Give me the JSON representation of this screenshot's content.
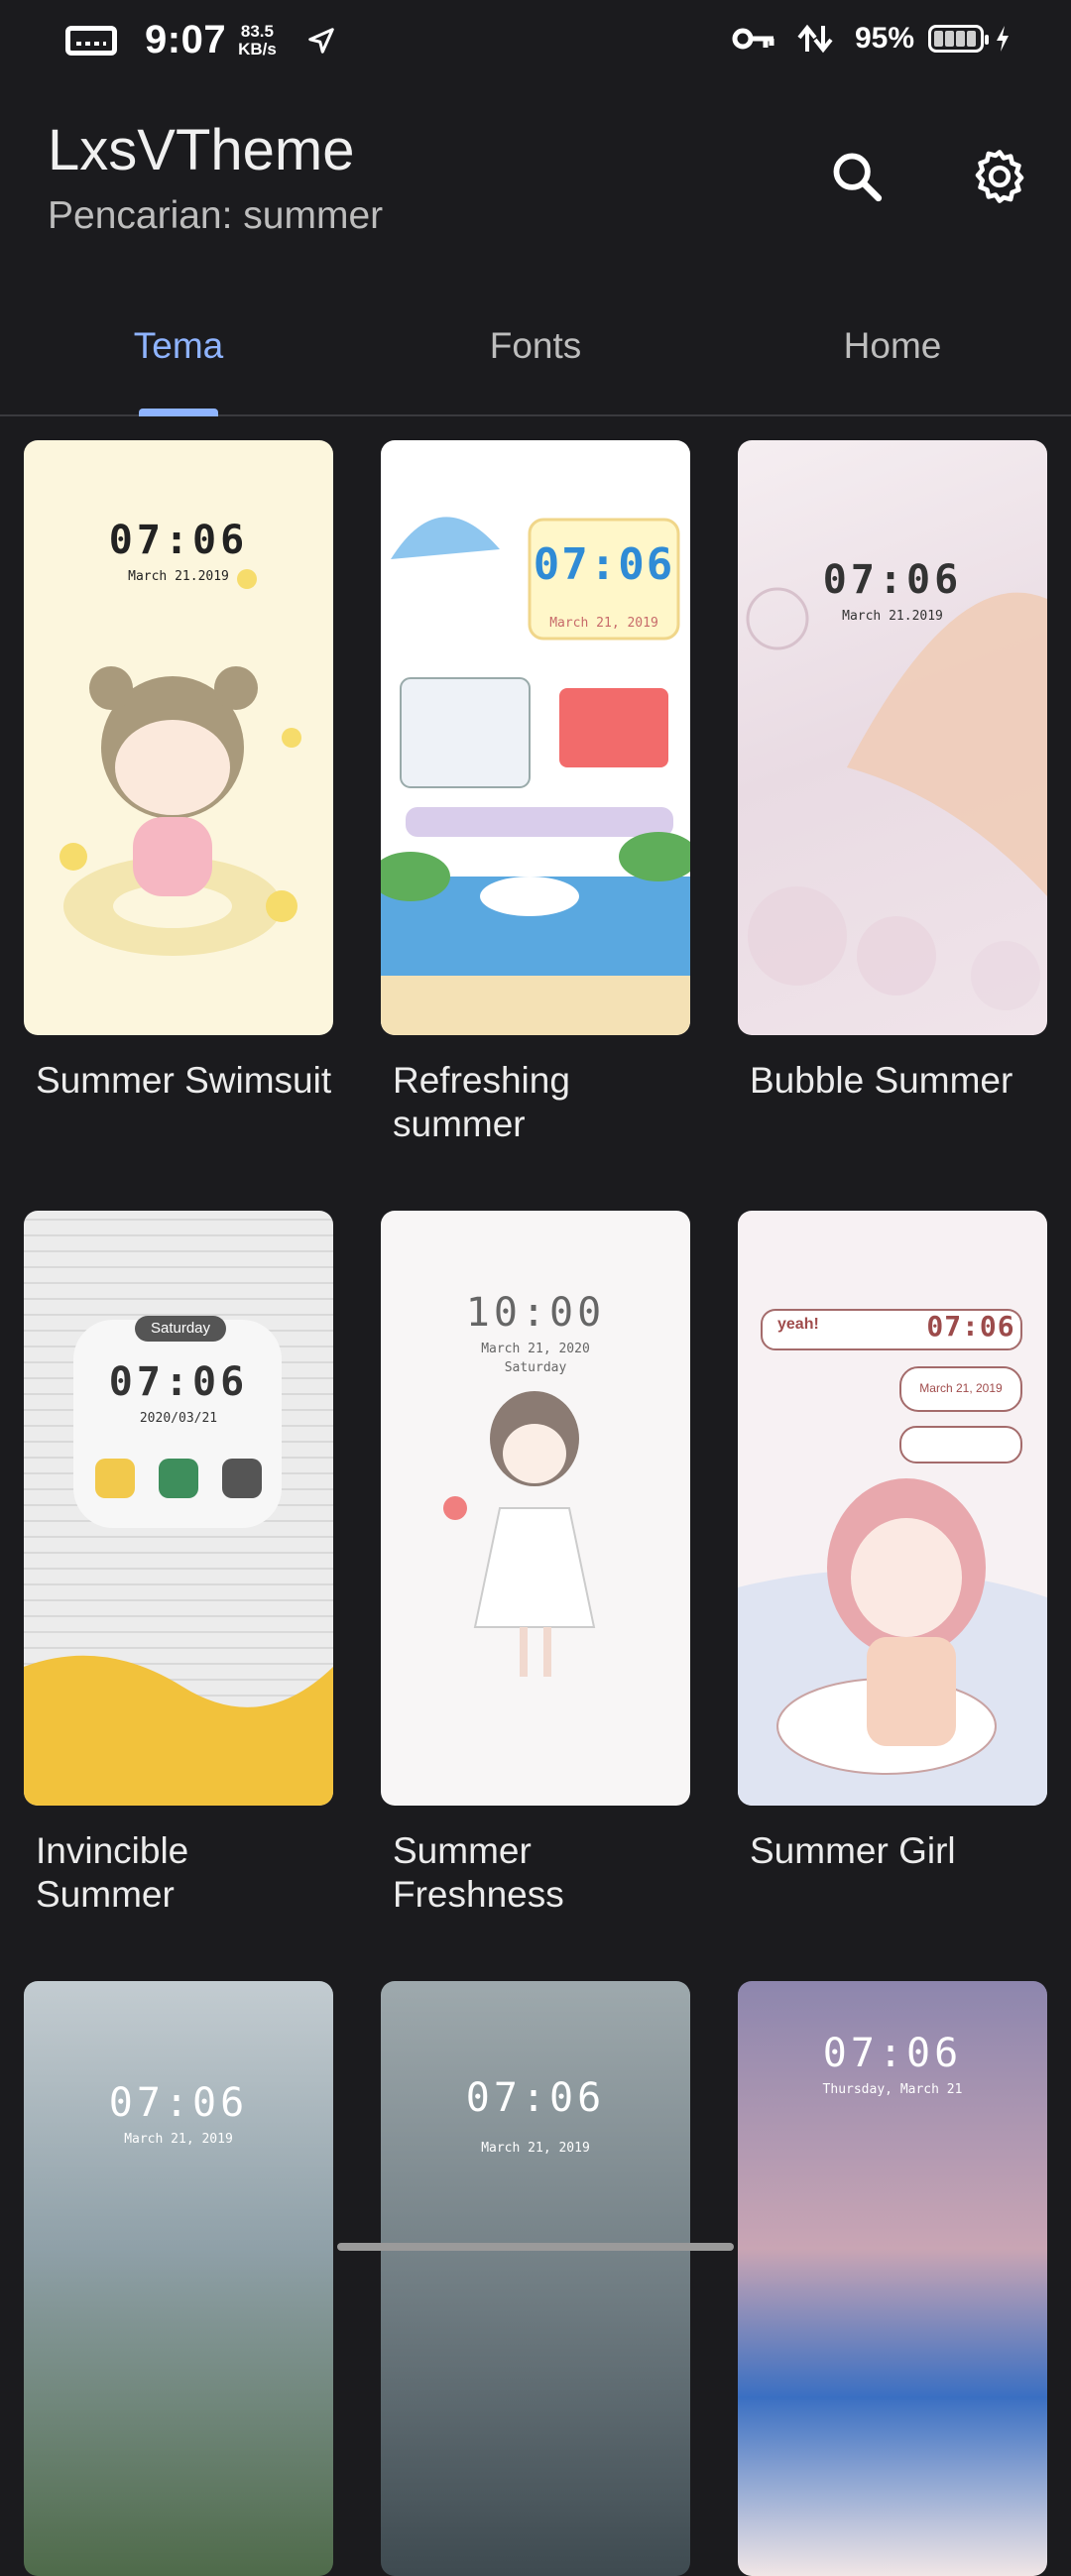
{
  "status_bar": {
    "time": "9:07",
    "speed_value": "83.5",
    "speed_unit": "KB/s",
    "battery": "95%"
  },
  "appbar": {
    "title": "LxsVTheme",
    "subtitle": "Pencarian: summer",
    "icons": [
      "search-icon",
      "gear-icon"
    ]
  },
  "tabs": [
    {
      "label": "Tema",
      "active": true
    },
    {
      "label": "Fonts",
      "active": false
    },
    {
      "label": "Home",
      "active": false
    }
  ],
  "themes": [
    {
      "title": "Summer Swimsuit",
      "clock": "07:06",
      "date": "March 21.2019",
      "bg": "#fcf6dd"
    },
    {
      "title": "Refreshing summer",
      "clock": "07:06",
      "date": "March 21, 2019",
      "bg": "#ffffff"
    },
    {
      "title": "Bubble Summer",
      "clock": "07:06",
      "date": "March 21.2019",
      "bg": "#efe6ec"
    },
    {
      "title": "Invincible Summer",
      "clock": "07:06",
      "date": "2020/03/21",
      "day": "Saturday",
      "bg": "#e6e6e6"
    },
    {
      "title": "Summer Freshness",
      "clock": "10:00",
      "date": "March 21, 2020",
      "day": "Saturday",
      "bg": "#f8f6f6"
    },
    {
      "title": "Summer Girl",
      "clock": "07:06",
      "date": "March 21, 2019",
      "day": "yeah!",
      "bg": "#f7f1f3"
    },
    {
      "title": "",
      "clock": "07:06",
      "date": "March 21, 2019",
      "bg": "#8fa0a8"
    },
    {
      "title": "",
      "clock": "07:06",
      "date": "March 21, 2019",
      "bg": "#6d7a80"
    },
    {
      "title": "",
      "clock": "07:06",
      "date": "Thursday, March 21",
      "bg": "#8d86ae"
    }
  ]
}
